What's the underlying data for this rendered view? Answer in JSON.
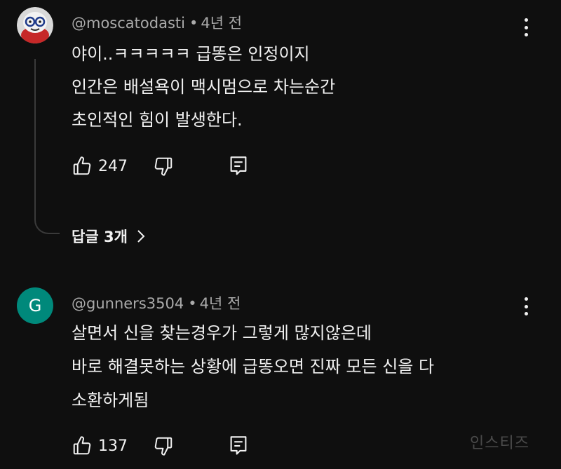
{
  "comments": [
    {
      "author": "@moscatodasti",
      "separator": "•",
      "time": "4년 전",
      "lines": [
        "야이..ㅋㅋㅋㅋㅋ 급똥은 인정이지",
        "인간은 배설욕이 맥시멈으로 차는순간",
        "초인적인 힘이 발생한다."
      ],
      "likes": "247",
      "replies_label": "답글 3개"
    },
    {
      "author": "@gunners3504",
      "separator": "•",
      "time": "4년 전",
      "avatar_letter": "G",
      "avatar_color": "#00897b",
      "lines": [
        "살면서 신을 찾는경우가 그렇게 많지않은데",
        "바로 해결못하는 상황에 급똥오면  진짜 모든 신을 다",
        "소환하게됨"
      ],
      "likes": "137"
    }
  ],
  "icons": {
    "like": "thumbs-up-icon",
    "dislike": "thumbs-down-icon",
    "reply": "reply-comment-icon",
    "more": "more-vertical-icon",
    "replies_arrow": "chevron-right-icon"
  },
  "watermark": "인스티즈",
  "colors": {
    "background": "#0f0f0f",
    "text": "#f1f1f1",
    "meta": "#aaaaaa"
  }
}
